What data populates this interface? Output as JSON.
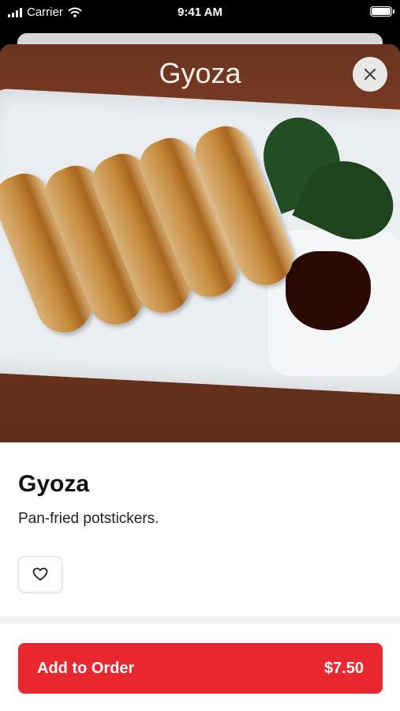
{
  "status_bar": {
    "carrier": "Carrier",
    "time": "9:41 AM"
  },
  "item": {
    "image_title": "Gyoza",
    "name": "Gyoza",
    "description": "Pan-fried potstickers."
  },
  "order": {
    "label": "Add to Order",
    "price": "$7.50"
  },
  "icons": {
    "close": "close-icon",
    "favorite": "heart-icon",
    "wifi": "wifi-icon",
    "signal": "signal-icon",
    "battery": "battery-icon"
  },
  "colors": {
    "accent": "#e8282e",
    "background": "#ffffff",
    "status_bar": "#000000"
  }
}
